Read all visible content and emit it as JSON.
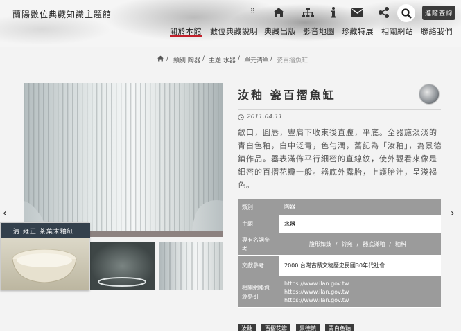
{
  "header": {
    "site_title": "蘭陽數位典藏知識主題館",
    "dots": "⠿",
    "query_label": "進階查詢",
    "nav": [
      "關於本館",
      "數位典藏說明",
      "典藏出版",
      "影音地圖",
      "珍藏特展",
      "相關網站",
      "聯絡我們"
    ]
  },
  "breadcrumb": {
    "items": [
      "類別 陶器",
      "主題 水器",
      "單元清單",
      "瓷百摺魚缸"
    ],
    "sep": "/"
  },
  "object": {
    "title": "汝釉 瓷百摺魚缸",
    "date": "2011.04.11",
    "description": "斂口，圓唇，豐肩下收束後直腹，平底。全器施淡淡的青白色釉，白中泛青，色勻潤，舊記為「汝釉」，為景德鎮作品。器表滿佈平行細密的直線紋，使外觀看來像是細密的百摺花瓣一般。器底外露胎，上護胎汁，呈淺褐色。"
  },
  "gallery": {
    "overlay_caption": "清 雍正 茶葉末釉缸",
    "prev": "‹",
    "next": "›"
  },
  "table": {
    "rows": [
      {
        "key": "類別",
        "value": "陶器"
      },
      {
        "key": "主題",
        "value": "水器"
      },
      {
        "key": "專有名詞參考",
        "keywords": [
          "腹形如鼓",
          "/",
          "鈴窯",
          "/",
          "器底滿釉",
          "/",
          "釉料"
        ]
      },
      {
        "key": "文獻參考",
        "value": "2000 台灣古蹟文物歷史民國30年代社會"
      },
      {
        "key": "相關網路資源參引",
        "links": [
          "https://www.ilan.gov.tw",
          "https://www.ilan.gov.tw",
          "https://www.ilan.gov.tw"
        ]
      }
    ]
  },
  "tags": [
    "汝釉",
    "百摺花瓣",
    "景德鎮",
    "青白色釉"
  ],
  "colors": {
    "accent": "#c3202b",
    "dark": "#3b3b3b",
    "table_gray": "#9b9b9b"
  }
}
